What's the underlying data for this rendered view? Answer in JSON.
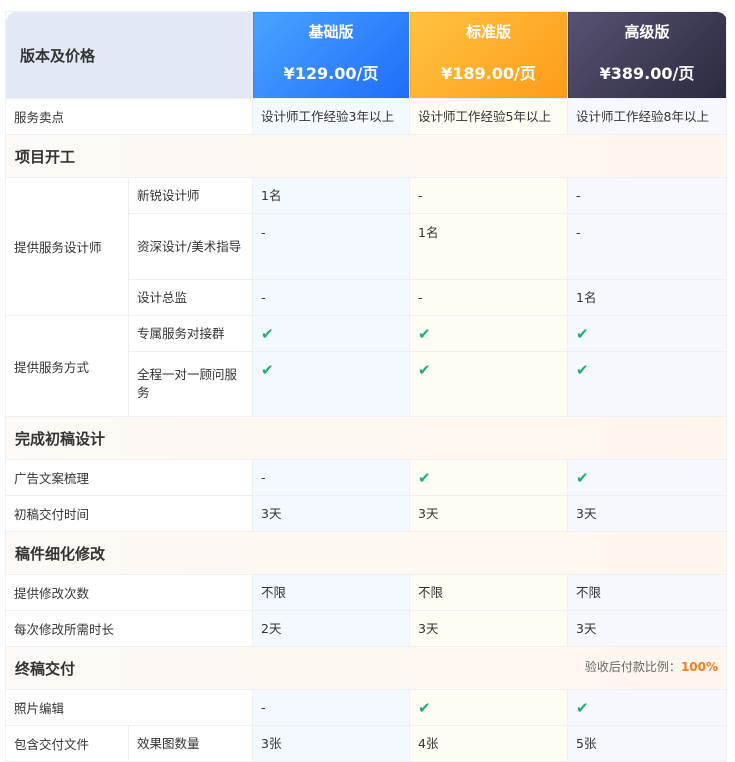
{
  "header": {
    "label": "版本及价格",
    "plans": [
      {
        "name": "基础版",
        "price": "¥129.00/页"
      },
      {
        "name": "标准版",
        "price": "¥189.00/页"
      },
      {
        "name": "高级版",
        "price": "¥389.00/页"
      }
    ]
  },
  "selling_point": {
    "label": "服务卖点",
    "values": [
      "设计师工作经验3年以上",
      "设计师工作经验5年以上",
      "设计师工作经验8年以上"
    ]
  },
  "sections": [
    {
      "title": "项目开工"
    },
    {
      "title": "完成初稿设计"
    },
    {
      "title": "稿件细化修改"
    },
    {
      "title": "终稿交付",
      "note_label": "验收后付款比例：",
      "note_value": "100%"
    }
  ],
  "groups": {
    "designers": {
      "label": "提供服务设计师",
      "rows": [
        {
          "sub": "新锐设计师",
          "values": [
            "1名",
            "-",
            "-"
          ]
        },
        {
          "sub": "资深设计/美术指导",
          "values": [
            "-",
            "1名",
            "-"
          ]
        },
        {
          "sub": "设计总监",
          "values": [
            "-",
            "-",
            "1名"
          ]
        }
      ]
    },
    "service_mode": {
      "label": "提供服务方式",
      "rows": [
        {
          "sub": "专属服务对接群",
          "values": [
            "✔",
            "✔",
            "✔"
          ]
        },
        {
          "sub": "全程一对一顾问服务",
          "values": [
            "✔",
            "✔",
            "✔"
          ]
        }
      ]
    },
    "draft": {
      "rows": [
        {
          "label": "广告文案梳理",
          "values": [
            "-",
            "✔",
            "✔"
          ]
        },
        {
          "label": "初稿交付时间",
          "values": [
            "3天",
            "3天",
            "3天"
          ]
        }
      ]
    },
    "revision": {
      "rows": [
        {
          "label": "提供修改次数",
          "values": [
            "不限",
            "不限",
            "不限"
          ]
        },
        {
          "label": "每次修改所需时长",
          "values": [
            "2天",
            "3天",
            "3天"
          ]
        }
      ]
    },
    "final": {
      "rows": [
        {
          "label": "照片编辑",
          "values": [
            "-",
            "✔",
            "✔"
          ]
        }
      ],
      "files": {
        "label": "包含交付文件",
        "sub": "效果图数量",
        "values": [
          "3张",
          "4张",
          "5张"
        ]
      }
    }
  }
}
